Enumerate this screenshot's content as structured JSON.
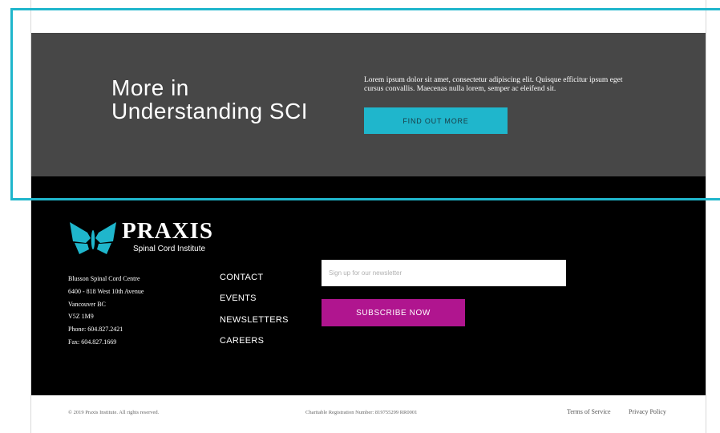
{
  "promo": {
    "title_line1": "More in",
    "title_line2": "Understanding SCI",
    "description": "Lorem ipsum dolor sit amet, consectetur adipiscing elit. Quisque efficitur ipsum eget cursus convallis. Maecenas nulla lorem, semper ac eleifend sit.",
    "button_label": "FIND OUT MORE"
  },
  "footer": {
    "logo": {
      "name": "PRAXIS",
      "subtitle": "Spinal Cord Institute",
      "icon": "butterfly-icon"
    },
    "address": [
      "Blusson Spinal Cord Centre",
      "6400 - 818 West 10th Avenue",
      "Vancouver BC",
      "V5Z 1M9",
      "Phone: 604.827.2421",
      "Fax: 604.827.1669"
    ],
    "nav": {
      "contact": "CONTACT",
      "events": "EVENTS",
      "newsletters": "NEWSLETTERS",
      "careers": "CAREERS"
    },
    "newsletter": {
      "placeholder": "Sign up for our newsletter",
      "button_label": "SUBSCRIBE NOW"
    }
  },
  "bottom_bar": {
    "copyright": "© 2019 Praxis Institute. All rights reserved.",
    "charity": "Charitable Registration Number: 819755299 RR0001",
    "terms": "Terms of Service",
    "privacy": "Privacy Policy"
  },
  "colors": {
    "accent_cyan": "#1fb6cc",
    "accent_magenta": "#b0158f",
    "promo_bg": "#474747",
    "footer_bg": "#000000"
  }
}
